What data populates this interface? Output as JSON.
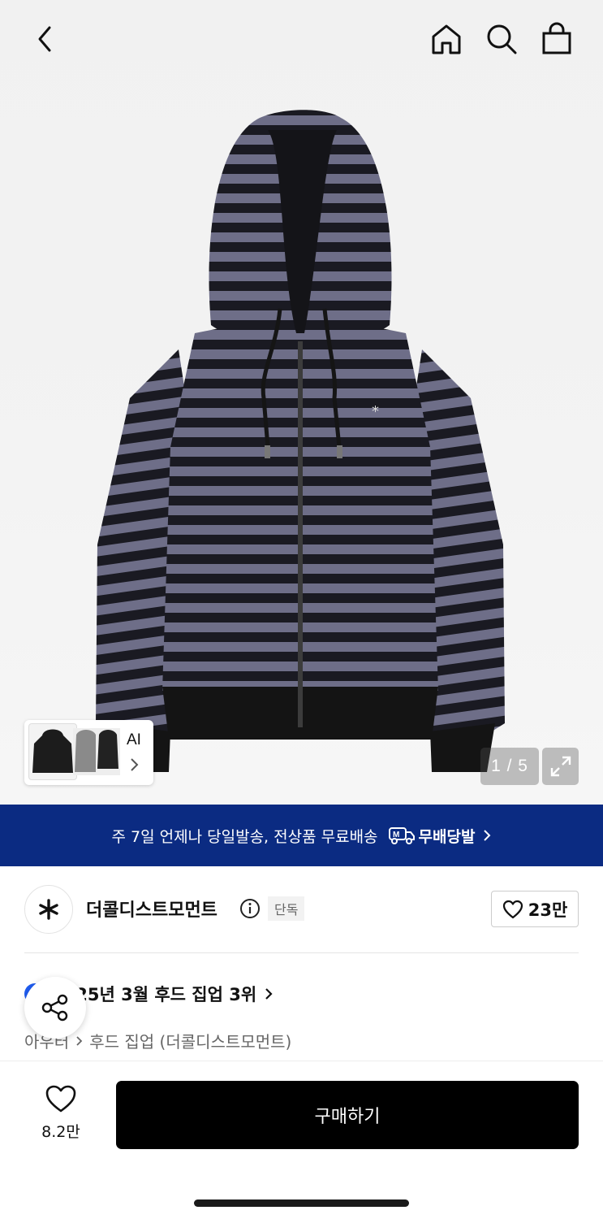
{
  "header": {
    "icons": [
      "back-icon",
      "home-icon",
      "search-icon",
      "bag-icon"
    ]
  },
  "gallery": {
    "ai_label": "AI",
    "counter": "1 / 5"
  },
  "banner": {
    "text": "주 7일 언제나 당일발송, 전상품 무료배송",
    "logo_text": "무배당발",
    "bg_color": "#0b2b82"
  },
  "brand": {
    "name": "더콜디스트모먼트",
    "badge": "단독",
    "likes": "23만"
  },
  "ranking": {
    "text": "2025년 3월 후드 집업 3위"
  },
  "breadcrumb": {
    "items": [
      "아우터",
      "후드 집업 (더콜디스트모먼트)"
    ]
  },
  "footer": {
    "wish_count": "8.2만",
    "buy_label": "구매하기"
  }
}
